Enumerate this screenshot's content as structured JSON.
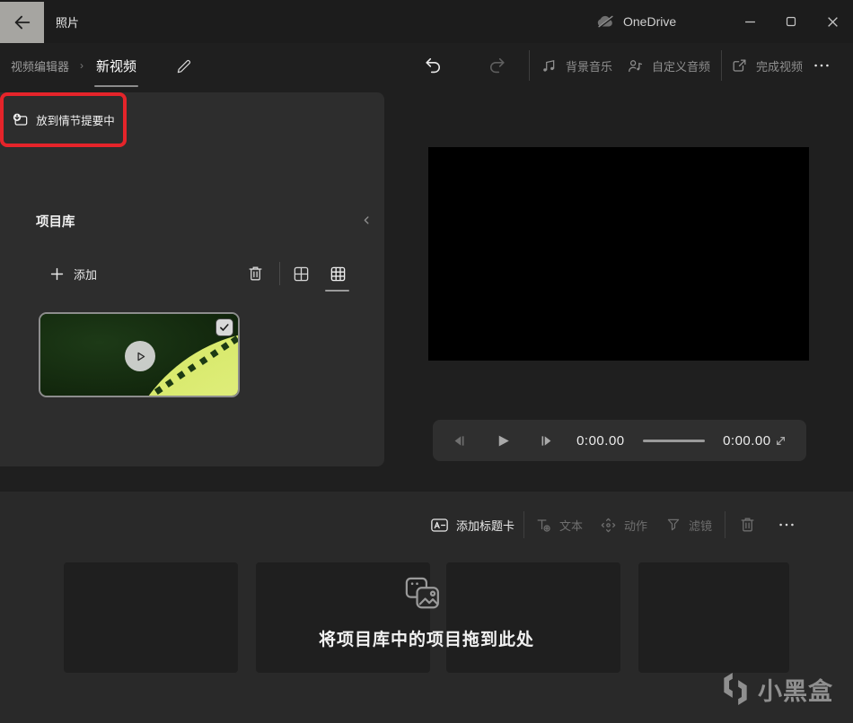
{
  "titlebar": {
    "app_title": "照片",
    "onedrive_label": "OneDrive"
  },
  "breadcrumb": {
    "root": "视频编辑器",
    "separator": "›",
    "current": "新视频"
  },
  "top_toolbar": {
    "background_music": "背景音乐",
    "custom_audio": "自定义音频",
    "finish_video": "完成视频",
    "more": "•••"
  },
  "library": {
    "title": "项目库",
    "add_label": "添加",
    "place_in_storyboard_label": "放到情节提要中"
  },
  "player": {
    "current_time": "0:00.00",
    "total_time": "0:00.00"
  },
  "storyboard_toolbar": {
    "add_title_card": "添加标题卡",
    "text_label": "文本",
    "motion_label": "动作",
    "filters_label": "滤镜",
    "more": "•••"
  },
  "storyboard": {
    "drop_hint": "将项目库中的项目拖到此处"
  },
  "watermark": {
    "brand": "小黑盒"
  },
  "colors": {
    "highlight_red": "#e5242a",
    "panel": "#2d2d2d",
    "background": "#1f1f1f"
  }
}
